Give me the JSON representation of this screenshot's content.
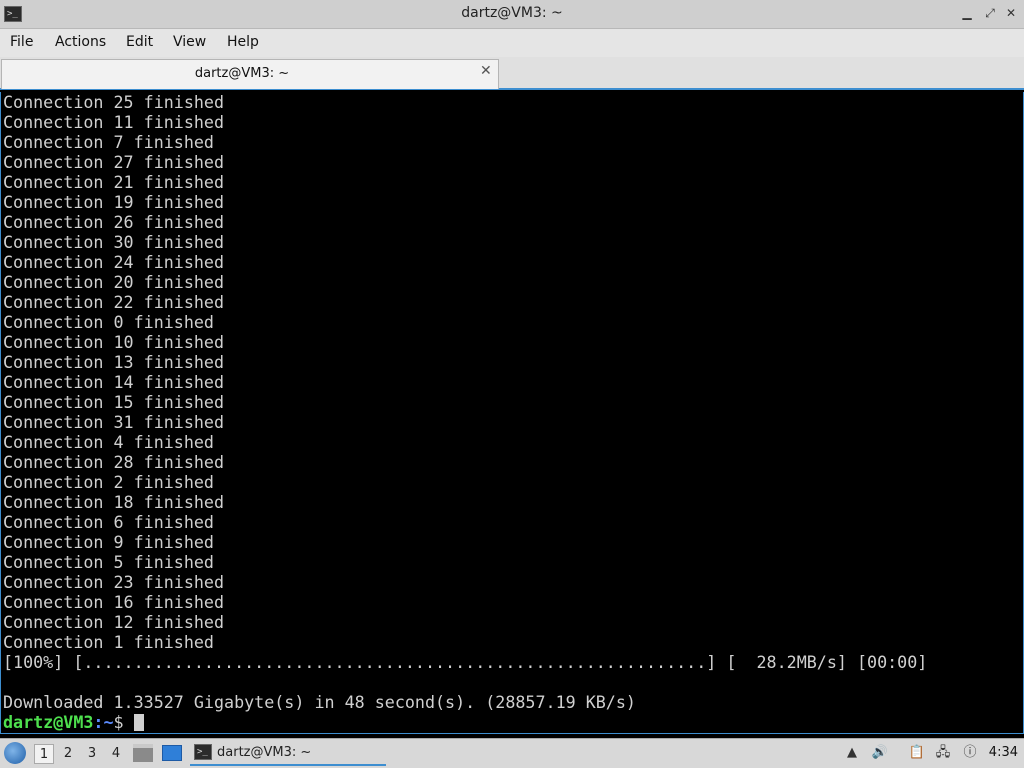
{
  "window": {
    "title": "dartz@VM3: ~",
    "app_icon": "terminal-icon",
    "controls": {
      "minimize": "▁",
      "maximize": "⤢",
      "close": "✕"
    }
  },
  "menubar": {
    "items": [
      "File",
      "Actions",
      "Edit",
      "View",
      "Help"
    ]
  },
  "tabs": [
    {
      "label": "dartz@VM3: ~",
      "close": "✕"
    }
  ],
  "terminal": {
    "lines": [
      "Connection 25 finished",
      "Connection 11 finished",
      "Connection 7 finished",
      "Connection 27 finished",
      "Connection 21 finished",
      "Connection 19 finished",
      "Connection 26 finished",
      "Connection 30 finished",
      "Connection 24 finished",
      "Connection 20 finished",
      "Connection 22 finished",
      "Connection 0 finished",
      "Connection 10 finished",
      "Connection 13 finished",
      "Connection 14 finished",
      "Connection 15 finished",
      "Connection 31 finished",
      "Connection 4 finished",
      "Connection 28 finished",
      "Connection 2 finished",
      "Connection 18 finished",
      "Connection 6 finished",
      "Connection 9 finished",
      "Connection 5 finished",
      "Connection 23 finished",
      "Connection 16 finished",
      "Connection 12 finished",
      "Connection 1 finished",
      "[100%] [..............................................................] [  28.2MB/s] [00:00]",
      "",
      "Downloaded 1.33527 Gigabyte(s) in 48 second(s). (28857.19 KB/s)"
    ],
    "prompt": {
      "user_host": "dartz@VM3",
      "path": ":~",
      "symbol": "$ "
    }
  },
  "taskbar": {
    "start_icon": "start-menu-icon",
    "workspaces": [
      "1",
      "2",
      "3",
      "4"
    ],
    "active_workspace": "1",
    "task_label": "dartz@VM3: ~",
    "tray_icons": [
      "keyboard-icon",
      "volume-icon",
      "clipboard-icon",
      "network-icon",
      "notification-icon",
      "layout-icon"
    ],
    "clock": "4:34",
    "colors": {
      "accent": "#3d8ed0",
      "prompt_user": "#4ee04e",
      "prompt_path": "#5c8cff",
      "terminal_fg": "#d0d0d0",
      "terminal_bg": "#000000"
    }
  }
}
